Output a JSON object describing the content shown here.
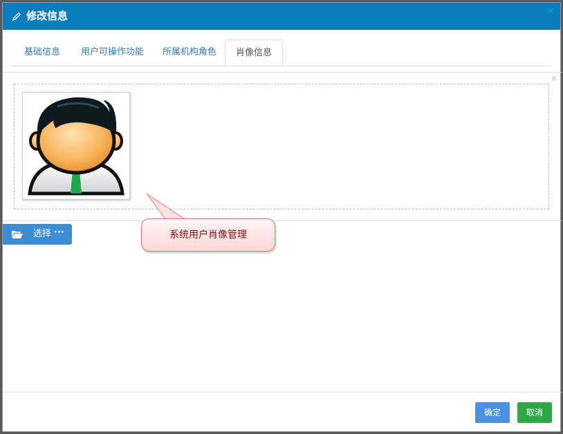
{
  "dialog": {
    "title": "修改信息",
    "close_glyph": "×"
  },
  "tabs": [
    {
      "label": "基础信息",
      "active": false
    },
    {
      "label": "用户可操作功能",
      "active": false
    },
    {
      "label": "所属机构角色",
      "active": false
    },
    {
      "label": "肖像信息",
      "active": true
    }
  ],
  "panel": {
    "close_glyph": "×",
    "avatar_icon": "default-user-avatar"
  },
  "select_button": {
    "label": "选择",
    "more": "···",
    "icon": "folder-open-icon"
  },
  "callout": {
    "text": "系统用户肖像管理"
  },
  "footer": {
    "ok_label": "确定",
    "cancel_label": "取消"
  },
  "colors": {
    "titlebar": "#0a7dbf",
    "ok": "#4a90e8",
    "cancel": "#2ea847",
    "select": "#3c8dd2",
    "callout_text": "#8a0d0d"
  }
}
